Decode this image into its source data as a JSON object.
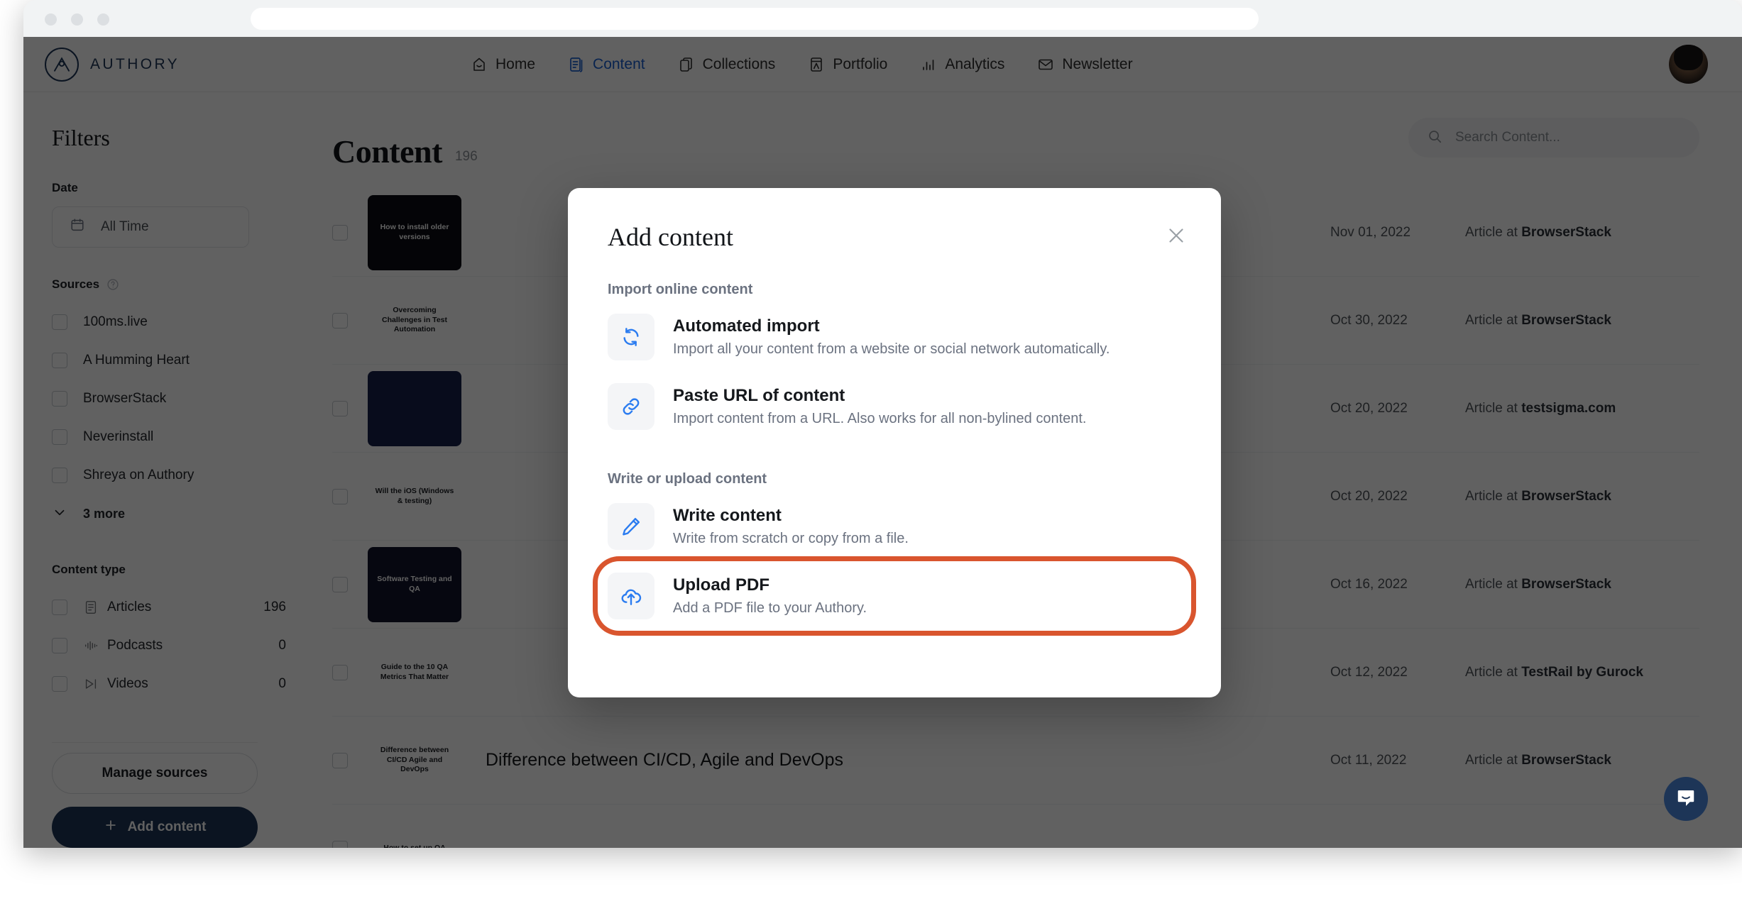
{
  "browser": {
    "url_value": "",
    "url_placeholder": ""
  },
  "brand": {
    "name": "AUTHORY"
  },
  "nav": {
    "items": [
      {
        "label": "Home",
        "icon": "home-icon",
        "active": false
      },
      {
        "label": "Content",
        "icon": "content-icon",
        "active": true
      },
      {
        "label": "Collections",
        "icon": "collections-icon",
        "active": false
      },
      {
        "label": "Portfolio",
        "icon": "portfolio-icon",
        "active": false
      },
      {
        "label": "Analytics",
        "icon": "analytics-icon",
        "active": false
      },
      {
        "label": "Newsletter",
        "icon": "newsletter-icon",
        "active": false
      }
    ]
  },
  "sidebar": {
    "title": "Filters",
    "date_label": "Date",
    "date_value": "All Time",
    "sources_label": "Sources",
    "sources": [
      {
        "label": "100ms.live"
      },
      {
        "label": "A Humming Heart"
      },
      {
        "label": "BrowserStack"
      },
      {
        "label": "Neverinstall"
      },
      {
        "label": "Shreya on Authory"
      }
    ],
    "more_label": "3 more",
    "content_type_label": "Content type",
    "content_types": [
      {
        "label": "Articles",
        "count": "196",
        "icon": "article-icon"
      },
      {
        "label": "Podcasts",
        "count": "0",
        "icon": "podcast-icon"
      },
      {
        "label": "Videos",
        "count": "0",
        "icon": "video-icon"
      }
    ],
    "manage_sources_label": "Manage sources",
    "add_content_label": "Add content"
  },
  "main": {
    "page_title": "Content",
    "page_count": "196",
    "search_placeholder": "Search Content...",
    "search_value": "",
    "rows": [
      {
        "thumb_text": "How to install older versions",
        "thumb_bg": "#0c0d14",
        "thumb_fg": "#ffffff",
        "title": "",
        "date": "Nov 01, 2022",
        "source_prefix": "Article at",
        "source": "BrowserStack"
      },
      {
        "thumb_text": "Overcoming Challenges in Test Automation",
        "thumb_bg": "#ffffff",
        "thumb_fg": "#1b1f24",
        "title": "",
        "date": "Oct 30, 2022",
        "source_prefix": "Article at",
        "source": "BrowserStack"
      },
      {
        "thumb_text": "",
        "thumb_bg": "#16214a",
        "thumb_fg": "#ffffff",
        "title": "",
        "date": "Oct 20, 2022",
        "source_prefix": "Article at",
        "source": "testsigma.com"
      },
      {
        "thumb_text": "Will the iOS (Windows & testing)",
        "thumb_bg": "#ffffff",
        "thumb_fg": "#1b1f24",
        "title": "",
        "date": "Oct 20, 2022",
        "source_prefix": "Article at",
        "source": "BrowserStack"
      },
      {
        "thumb_text": "Software Testing and QA",
        "thumb_bg": "#12132b",
        "thumb_fg": "#ffffff",
        "title": "",
        "date": "Oct 16, 2022",
        "source_prefix": "Article at",
        "source": "BrowserStack"
      },
      {
        "thumb_text": "Guide to the 10 QA Metrics That Matter",
        "thumb_bg": "#ffffff",
        "thumb_fg": "#1b1f24",
        "title": "",
        "date": "Oct 12, 2022",
        "source_prefix": "Article at",
        "source": "TestRail by Gurock"
      },
      {
        "thumb_text": "Difference between CI/CD Agile and DevOps",
        "thumb_bg": "#ffffff",
        "thumb_fg": "#1b1f24",
        "title": "Difference between CI/CD, Agile and DevOps",
        "date": "Oct 11, 2022",
        "source_prefix": "Article at",
        "source": "BrowserStack"
      },
      {
        "thumb_text": "How to set up QA",
        "thumb_bg": "#ffffff",
        "thumb_fg": "#1b1f24",
        "title": "",
        "date": "",
        "source_prefix": "",
        "source": ""
      }
    ]
  },
  "modal": {
    "title": "Add content",
    "section_online": "Import online content",
    "section_write": "Write or upload content",
    "options": [
      {
        "icon": "refresh-sync-icon",
        "title": "Automated import",
        "desc": "Import all your content from a website or social network automatically.",
        "highlighted": false
      },
      {
        "icon": "link-chain-icon",
        "title": "Paste URL of content",
        "desc": "Import content from a URL. Also works for all non-bylined content.",
        "highlighted": false
      },
      {
        "icon": "pencil-icon",
        "title": "Write content",
        "desc": "Write from scratch or copy from a file.",
        "highlighted": false
      },
      {
        "icon": "cloud-upload-icon",
        "title": "Upload PDF",
        "desc": "Add a PDF file to your Authory.",
        "highlighted": true
      }
    ]
  },
  "colors": {
    "brand_navy": "#1d3557",
    "accent_blue": "#1a5fd0",
    "icon_blue": "#2b7cf0",
    "highlight_orange": "#d9552e",
    "overlay": "rgba(0,0,0,0.62)"
  },
  "widgets": {
    "intercom_label": "intercom-chat-launcher"
  }
}
